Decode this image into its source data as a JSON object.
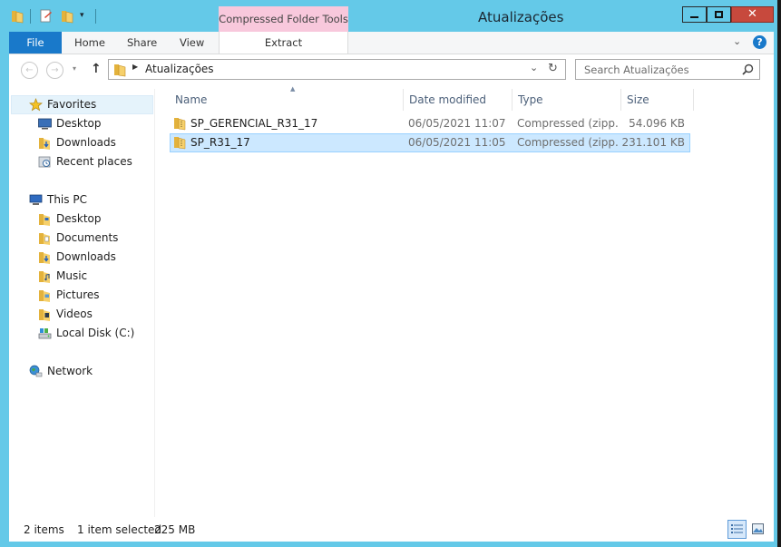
{
  "window": {
    "title": "Atualizações",
    "contextual_tab_group": "Compressed Folder Tools",
    "accent_color": "#64c9e8"
  },
  "ribbon": {
    "tabs": [
      {
        "label": "File"
      },
      {
        "label": "Home"
      },
      {
        "label": "Share"
      },
      {
        "label": "View"
      },
      {
        "label": "Extract"
      }
    ],
    "help_icon": "help-icon"
  },
  "address_bar": {
    "path": "Atualizações",
    "search_placeholder": "Search Atualizações"
  },
  "nav_pane": {
    "favorites": {
      "label": "Favorites",
      "items": [
        {
          "label": "Desktop",
          "icon": "desktop-icon"
        },
        {
          "label": "Downloads",
          "icon": "downloads-icon"
        },
        {
          "label": "Recent places",
          "icon": "recent-places-icon"
        }
      ]
    },
    "this_pc": {
      "label": "This PC",
      "items": [
        {
          "label": "Desktop",
          "icon": "desktop-icon"
        },
        {
          "label": "Documents",
          "icon": "documents-icon"
        },
        {
          "label": "Downloads",
          "icon": "downloads-icon"
        },
        {
          "label": "Music",
          "icon": "music-icon"
        },
        {
          "label": "Pictures",
          "icon": "pictures-icon"
        },
        {
          "label": "Videos",
          "icon": "videos-icon"
        },
        {
          "label": "Local Disk (C:)",
          "icon": "local-disk-icon"
        }
      ]
    },
    "network": {
      "label": "Network",
      "icon": "network-icon"
    }
  },
  "file_list": {
    "columns": [
      "Name",
      "Date modified",
      "Type",
      "Size"
    ],
    "sort_column": "Name",
    "rows": [
      {
        "name": "SP_GERENCIAL_R31_17",
        "date": "06/05/2021 11:07",
        "type": "Compressed (zipp...",
        "size": "54.096 KB",
        "selected": false
      },
      {
        "name": "SP_R31_17",
        "date": "06/05/2021 11:05",
        "type": "Compressed (zipp...",
        "size": "231.101 KB",
        "selected": true
      }
    ]
  },
  "status_bar": {
    "item_count": "2 items",
    "selection": "1 item selected",
    "selection_size": "225 MB"
  }
}
